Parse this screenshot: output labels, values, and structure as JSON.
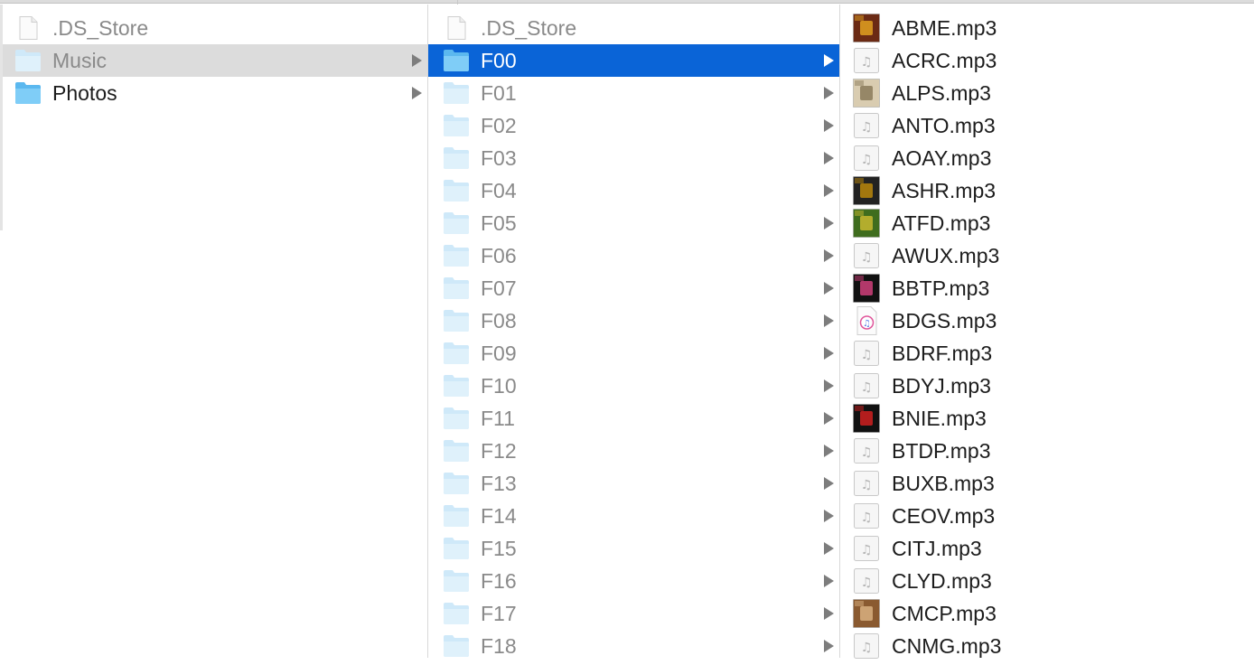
{
  "columns": [
    {
      "rows": [
        {
          "label": ".DS_Store",
          "icon": "document-icon",
          "state": "dim",
          "folder": false
        },
        {
          "label": "Music",
          "icon": "folder-icon",
          "state": "selected-inactive",
          "folder": true
        },
        {
          "label": "Photos",
          "icon": "folder-icon",
          "state": "normal",
          "folder": true
        }
      ]
    },
    {
      "rows": [
        {
          "label": ".DS_Store",
          "icon": "document-icon",
          "state": "dim",
          "folder": false
        },
        {
          "label": "F00",
          "icon": "folder-icon",
          "state": "selected",
          "folder": true
        },
        {
          "label": "F01",
          "icon": "folder-icon",
          "state": "dim",
          "folder": true
        },
        {
          "label": "F02",
          "icon": "folder-icon",
          "state": "dim",
          "folder": true
        },
        {
          "label": "F03",
          "icon": "folder-icon",
          "state": "dim",
          "folder": true
        },
        {
          "label": "F04",
          "icon": "folder-icon",
          "state": "dim",
          "folder": true
        },
        {
          "label": "F05",
          "icon": "folder-icon",
          "state": "dim",
          "folder": true
        },
        {
          "label": "F06",
          "icon": "folder-icon",
          "state": "dim",
          "folder": true
        },
        {
          "label": "F07",
          "icon": "folder-icon",
          "state": "dim",
          "folder": true
        },
        {
          "label": "F08",
          "icon": "folder-icon",
          "state": "dim",
          "folder": true
        },
        {
          "label": "F09",
          "icon": "folder-icon",
          "state": "dim",
          "folder": true
        },
        {
          "label": "F10",
          "icon": "folder-icon",
          "state": "dim",
          "folder": true
        },
        {
          "label": "F11",
          "icon": "folder-icon",
          "state": "dim",
          "folder": true
        },
        {
          "label": "F12",
          "icon": "folder-icon",
          "state": "dim",
          "folder": true
        },
        {
          "label": "F13",
          "icon": "folder-icon",
          "state": "dim",
          "folder": true
        },
        {
          "label": "F14",
          "icon": "folder-icon",
          "state": "dim",
          "folder": true
        },
        {
          "label": "F15",
          "icon": "folder-icon",
          "state": "dim",
          "folder": true
        },
        {
          "label": "F16",
          "icon": "folder-icon",
          "state": "dim",
          "folder": true
        },
        {
          "label": "F17",
          "icon": "folder-icon",
          "state": "dim",
          "folder": true
        },
        {
          "label": "F18",
          "icon": "folder-icon",
          "state": "dim",
          "folder": true
        }
      ]
    },
    {
      "rows": [
        {
          "label": "ABME.mp3",
          "icon": "album-art-icon",
          "art": [
            "#6b2a14",
            "#e0a020"
          ]
        },
        {
          "label": "ACRC.mp3",
          "icon": "audio-file-icon"
        },
        {
          "label": "ALPS.mp3",
          "icon": "album-art-icon",
          "art": [
            "#d9ccb0",
            "#8a7a5a"
          ]
        },
        {
          "label": "ANTO.mp3",
          "icon": "audio-file-icon"
        },
        {
          "label": "AOAY.mp3",
          "icon": "audio-file-icon"
        },
        {
          "label": "ASHR.mp3",
          "icon": "album-art-icon",
          "art": [
            "#222222",
            "#b8860b"
          ]
        },
        {
          "label": "ATFD.mp3",
          "icon": "album-art-icon",
          "art": [
            "#3f6d1e",
            "#c8b830"
          ]
        },
        {
          "label": "AWUX.mp3",
          "icon": "audio-file-icon"
        },
        {
          "label": "BBTP.mp3",
          "icon": "album-art-icon",
          "art": [
            "#111111",
            "#d0407a"
          ]
        },
        {
          "label": "BDGS.mp3",
          "icon": "itunes-file-icon"
        },
        {
          "label": "BDRF.mp3",
          "icon": "audio-file-icon"
        },
        {
          "label": "BDYJ.mp3",
          "icon": "audio-file-icon"
        },
        {
          "label": "BNIE.mp3",
          "icon": "album-art-icon",
          "art": [
            "#111111",
            "#d02020"
          ]
        },
        {
          "label": "BTDP.mp3",
          "icon": "audio-file-icon"
        },
        {
          "label": "BUXB.mp3",
          "icon": "audio-file-icon"
        },
        {
          "label": "CEOV.mp3",
          "icon": "audio-file-icon"
        },
        {
          "label": "CITJ.mp3",
          "icon": "audio-file-icon"
        },
        {
          "label": "CLYD.mp3",
          "icon": "audio-file-icon"
        },
        {
          "label": "CMCP.mp3",
          "icon": "album-art-icon",
          "art": [
            "#8a5a30",
            "#d8b080"
          ]
        },
        {
          "label": "CNMG.mp3",
          "icon": "audio-file-icon"
        }
      ]
    }
  ],
  "colors": {
    "selection_blue": "#0a64d7",
    "selection_gray": "#dcdcdc",
    "folder_blue": "#74c7f5",
    "folder_light": "#cfe9f9",
    "text": "#1c1c1c",
    "text_dim": "#8a8a8a"
  }
}
